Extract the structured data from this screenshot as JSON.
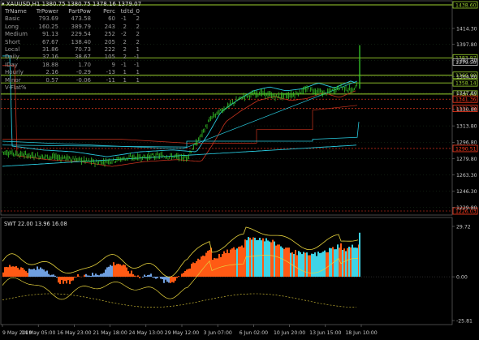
{
  "header": {
    "symbol_line": "XAUUSD,H1  1380.75 1380.75 1378.16 1379.07",
    "close_icon": "x-icon"
  },
  "table": {
    "columns": [
      "TrName",
      "TrPower",
      "PartPow",
      "Perc",
      "td",
      "td_0"
    ],
    "rows": [
      [
        "Basic",
        "793.69",
        "473.58",
        "60",
        "-1",
        "2"
      ],
      [
        "Long",
        "160.25",
        "389.79",
        "243",
        "2",
        "2"
      ],
      [
        "Medium",
        "91.13",
        "229.54",
        "252",
        "-2",
        "2"
      ],
      [
        "Short",
        "67.67",
        "138.40",
        "205",
        "2",
        "2"
      ],
      [
        "Local",
        "31.86",
        "70.73",
        "222",
        "2",
        "1"
      ],
      [
        "Daily",
        "37.16",
        "38.67",
        "105",
        "2",
        "-1"
      ],
      [
        "IDay",
        "18.88",
        "1.70",
        "9",
        "-1",
        "-1"
      ],
      [
        "Hourly",
        "2.16",
        "-0.29",
        "-13",
        "1",
        "1"
      ],
      [
        "Minor",
        "0.57",
        "-0.06",
        "-11",
        "1",
        "1"
      ],
      [
        "V-Flat%",
        "",
        "",
        "",
        "",
        ""
      ]
    ]
  },
  "price_axis": {
    "ticks": [
      "1414.30",
      "1397.80",
      "1381.30",
      "1364.80",
      "1347.80",
      "1330.80",
      "1313.80",
      "1296.80",
      "1279.80",
      "1263.30",
      "1246.30",
      "1229.80"
    ]
  },
  "price_labels": [
    {
      "text": "1438.60",
      "color": "#9bd22e"
    },
    {
      "text": "1383.97",
      "color": "#9bd22e"
    },
    {
      "text": "1379.50",
      "color": "#c8c8c8"
    },
    {
      "text": "1366.00",
      "color": "#9bd22e"
    },
    {
      "text": "1358.14",
      "color": "#9bd22e"
    },
    {
      "text": "1346.64",
      "color": "#9bd22e"
    },
    {
      "text": "1341.36",
      "color": "#ff3b1e"
    },
    {
      "text": "1331.78",
      "color": "#ff3b1e"
    },
    {
      "text": "1290.51",
      "color": "#ff3b1e"
    },
    {
      "text": "1226.03",
      "color": "#ff3b1e"
    }
  ],
  "indicator": {
    "label": "SWT 22.00 13.96 16.08",
    "ticks": [
      "29.72",
      "0.00",
      "-25.81"
    ]
  },
  "time_axis": {
    "ticks": [
      "9 May 2019",
      "14 May 05:00",
      "16 May 23:00",
      "21 May 18:00",
      "24 May 13:00",
      "29 May 12:00",
      "3 Jun 07:00",
      "6 Jun 02:00",
      "10 Jun 20:00",
      "13 Jun 15:00",
      "18 Jun 10:00"
    ]
  },
  "colors": {
    "background": "#000000",
    "grid": "#1e3a1e",
    "candle": "#39d82c",
    "level_green": "#9bd22e",
    "level_red": "#ff3b1e",
    "cyan": "#28c8dc",
    "red_ma": "#c8321e",
    "yellow": "#e6d23c",
    "osc_cyan": "#3fd4e6",
    "osc_orange": "#ff5a14",
    "osc_blue": "#6fa0e0",
    "axis_text": "#c8c8c8"
  }
}
